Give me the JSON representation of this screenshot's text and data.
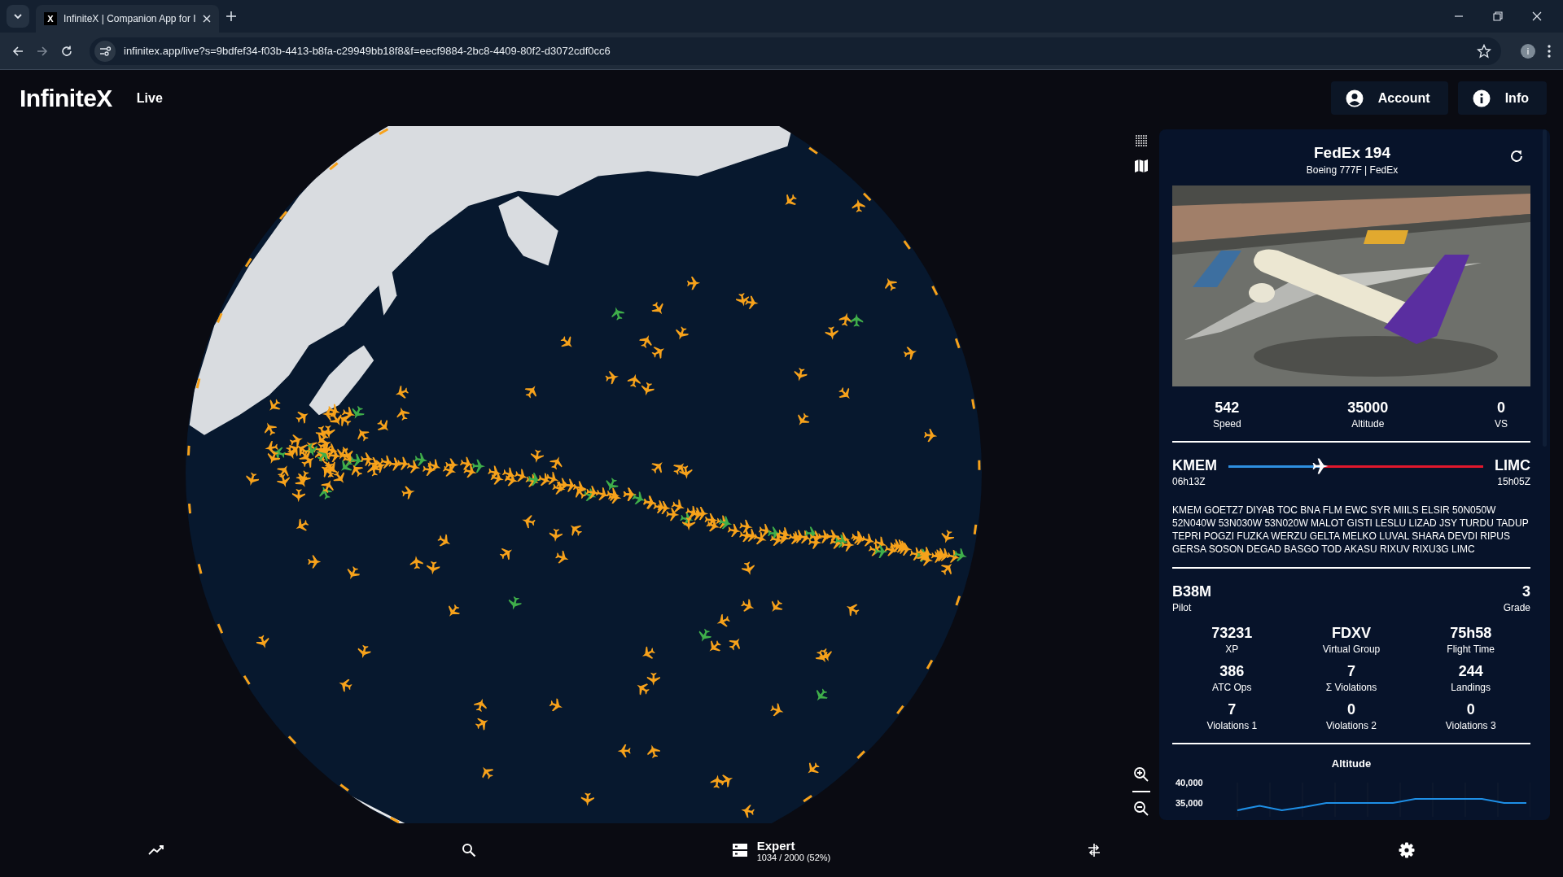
{
  "browser": {
    "tab_icon": "X",
    "tab_title": "InfiniteX | Companion App for I",
    "url": "infinitex.app/live?s=9bdfef34-f03b-4413-b8fa-c29949bb18f8&f=eecf9884-2bc8-4409-80f2-d3072cdf0cc6",
    "profile_initial": "i"
  },
  "header": {
    "logo": "InfiniteX",
    "mode": "Live",
    "buttons": [
      {
        "kind": "account",
        "label": "Account"
      },
      {
        "kind": "info",
        "label": "Info"
      }
    ]
  },
  "flight": {
    "callsign": "FedEx 194",
    "aircraft": "Boeing 777F | FedEx",
    "stats": [
      {
        "value": "542",
        "label": "Speed"
      },
      {
        "value": "35000",
        "label": "Altitude"
      },
      {
        "value": "0",
        "label": "VS"
      }
    ],
    "origin": {
      "code": "KMEM",
      "time": "06h13Z"
    },
    "destination": {
      "code": "LIMC",
      "time": "15h05Z"
    },
    "progress": {
      "level": 0.36
    },
    "route": "KMEM GOETZ7 DIYAB TOC BNA FLM EWC SYR MIILS ELSIR 50N050W 52N040W 53N030W 53N020W MALOT GISTI LESLU LIZAD JSY TURDU TADUP TEPRI POGZI FUZKA WERZU GELTA MELKO LUVAL SHARA DEVDI RIPUS GERSA SOSON DEGAD BASGO TOD AKASU RIXUV RIXU3G LIMC"
  },
  "pilot": {
    "name": "B38M",
    "name_label": "Pilot",
    "grade": "3",
    "grade_label": "Grade",
    "stats": [
      {
        "value": "73231",
        "label": "XP"
      },
      {
        "value": "FDXV",
        "label": "Virtual Group"
      },
      {
        "value": "75h58",
        "label": "Flight Time"
      },
      {
        "value": "386",
        "label": "ATC Ops"
      },
      {
        "value": "7",
        "label": "Σ Violations"
      },
      {
        "value": "244",
        "label": "Landings"
      },
      {
        "value": "7",
        "label": "Violations 1"
      },
      {
        "value": "0",
        "label": "Violations 2"
      },
      {
        "value": "0",
        "label": "Violations 3"
      }
    ]
  },
  "altitude_chart": {
    "chart_data": {
      "type": "line",
      "title": "Altitude",
      "yticks": [
        {
          "value": 40000,
          "label": "40,000"
        },
        {
          "value": 35000,
          "label": "35,000"
        }
      ],
      "ylim": [
        31600,
        40000
      ],
      "categories": [
        null,
        null,
        null,
        null,
        null,
        null,
        null,
        null,
        null,
        null,
        null,
        null,
        null,
        null
      ],
      "series": [
        {
          "color": "#1e8fe6",
          "values": [
            33200,
            34300,
            33200,
            34000,
            35000,
            35000,
            35000,
            35000,
            36000,
            36000,
            36000,
            36000,
            35000,
            35000
          ]
        }
      ]
    }
  },
  "bottom_nav": {
    "server": "Expert",
    "capacity": "1034 / 2000 (52%)"
  }
}
